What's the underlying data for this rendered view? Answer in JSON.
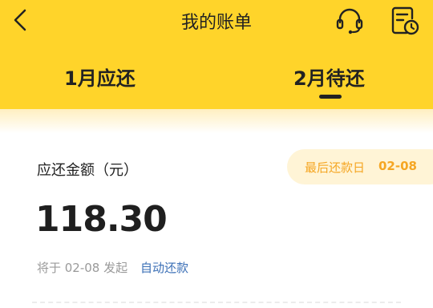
{
  "header": {
    "title": "我的账单",
    "back_icon": "chevron-left-icon",
    "support_icon": "headset-icon",
    "record_icon": "bill-clock-icon",
    "background": "#FFD42A"
  },
  "tabs": [
    {
      "label": "1月应还",
      "active": false
    },
    {
      "label": "2月待还",
      "active": true
    }
  ],
  "bill": {
    "amount_label": "应还金额（元）",
    "amount": "118.30",
    "due_label": "最后还款日",
    "due_date": "02-08",
    "note_prefix": "将于 02-08 发起",
    "note_link": "自动还款"
  },
  "colors": {
    "accent": "#F5A623",
    "link": "#3B6FB6",
    "pill": "#FFF4D6"
  }
}
